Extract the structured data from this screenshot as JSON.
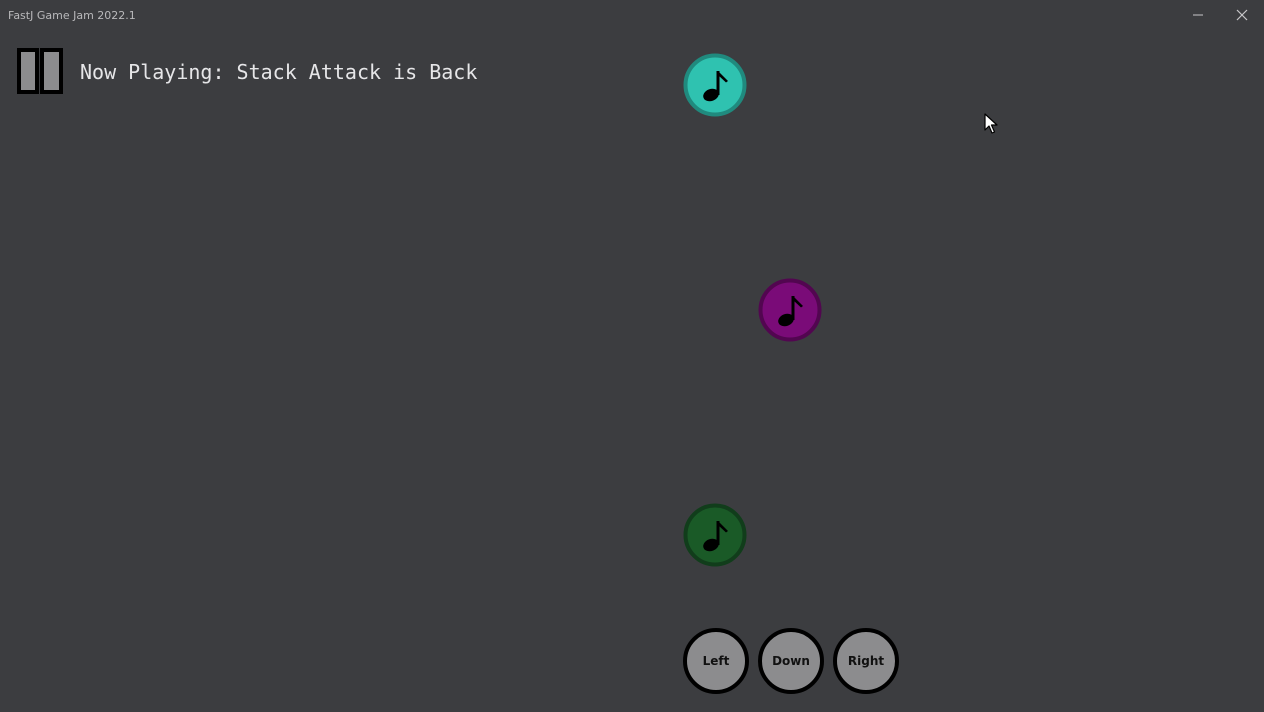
{
  "window": {
    "title": "FastJ Game Jam 2022.1",
    "controls": [
      "minimize-icon",
      "close-icon"
    ]
  },
  "hud": {
    "pause_icon": "pause-icon",
    "now_playing": "Now Playing: Stack Attack is Back"
  },
  "notes": [
    {
      "lane": "Left",
      "color": "#2fc2b0",
      "rim": "#208a7e",
      "icon": "music-note-icon"
    },
    {
      "lane": "Down",
      "color": "#7a0b78",
      "rim": "#520650",
      "icon": "music-note-icon"
    },
    {
      "lane": "Left",
      "color": "#1a5a27",
      "rim": "#113d1b",
      "icon": "music-note-icon"
    }
  ],
  "receptors": [
    {
      "label": "Left"
    },
    {
      "label": "Down"
    },
    {
      "label": "Right"
    }
  ],
  "colors": {
    "background": "#3c3d40",
    "receptor_fill": "#8c8c8e",
    "receptor_border": "#000000",
    "hud_text": "#e6e6e8"
  }
}
